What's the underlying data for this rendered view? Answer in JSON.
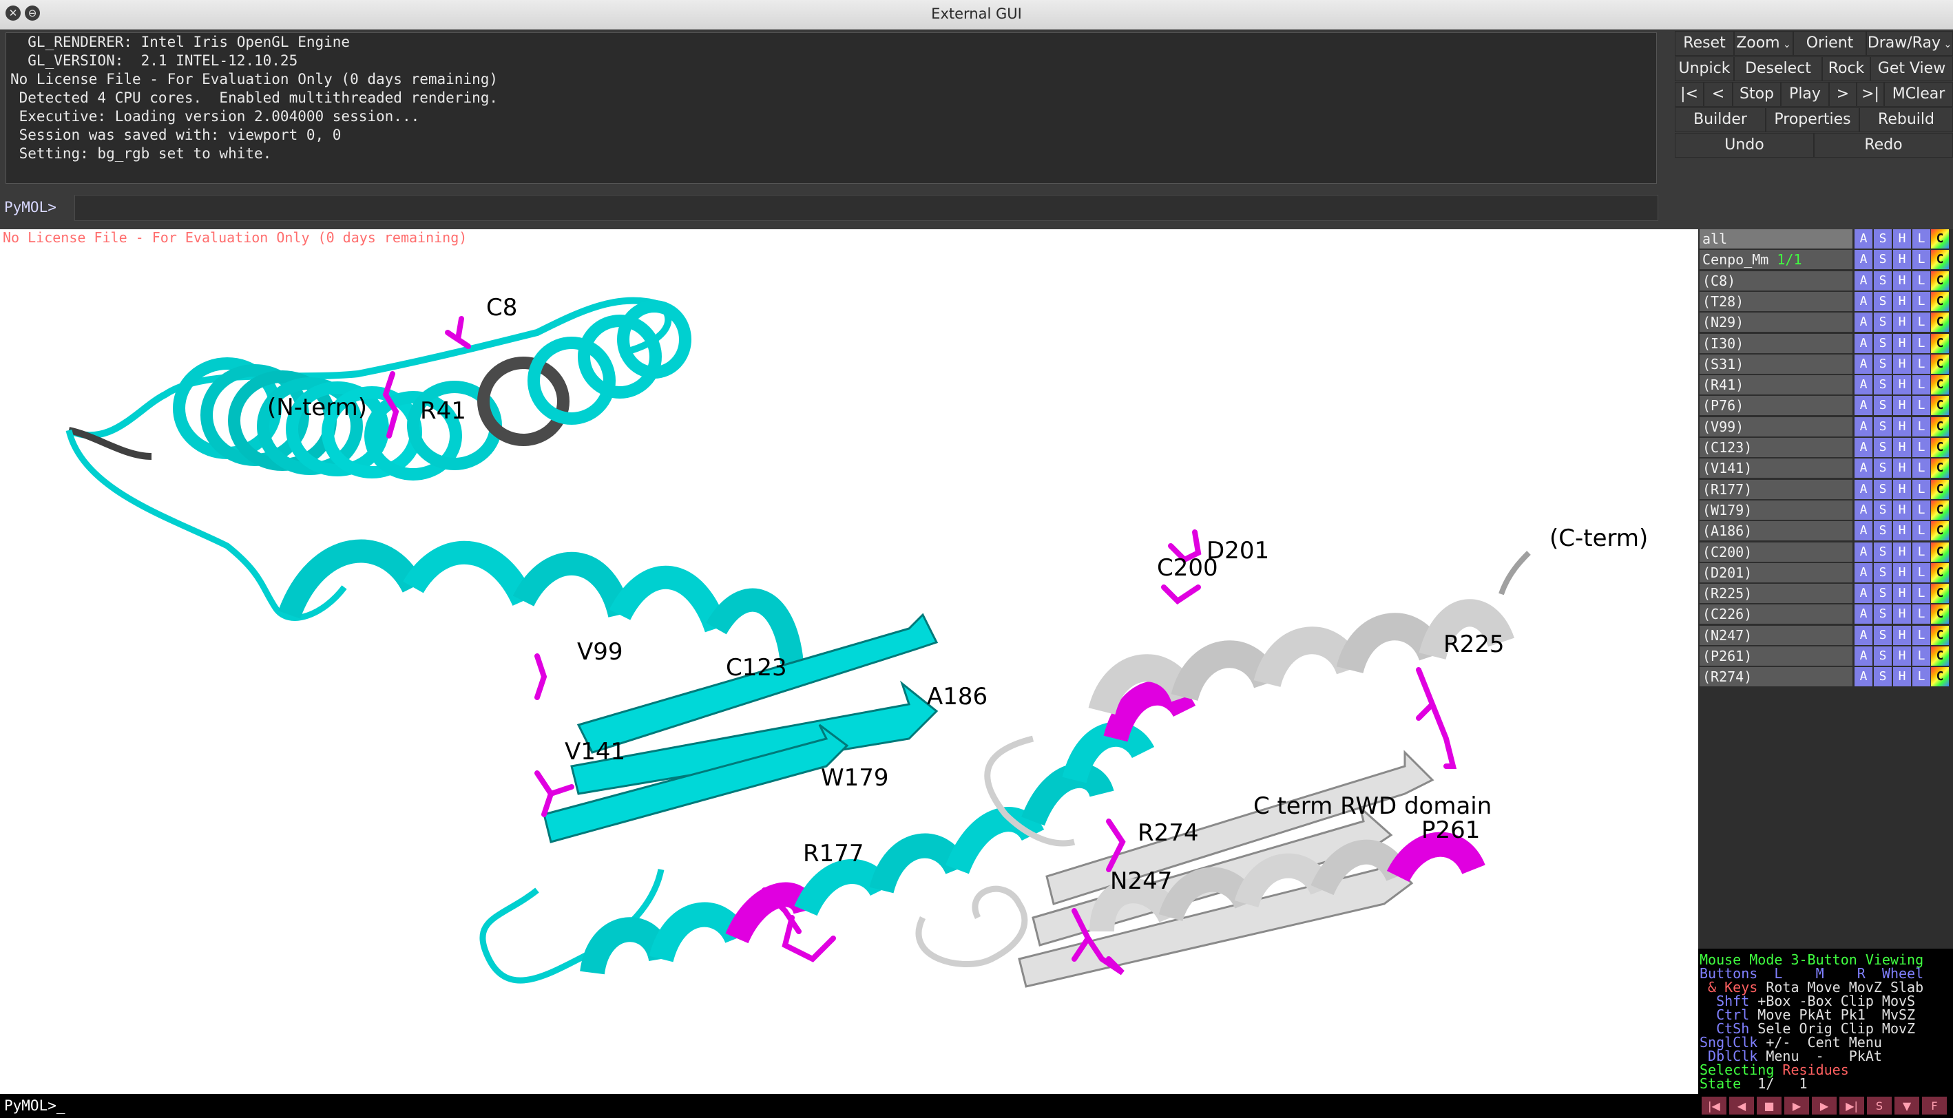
{
  "window": {
    "title": "External GUI"
  },
  "console": {
    "lines": [
      "  GL_RENDERER: Intel Iris OpenGL Engine",
      "  GL_VERSION:  2.1 INTEL-12.10.25",
      "No License File - For Evaluation Only (0 days remaining)",
      " Detected 4 CPU cores.  Enabled multithreaded rendering.",
      " Executive: Loading version 2.004000 session...",
      " Session was saved with: viewport 0, 0",
      " Setting: bg_rgb set to white."
    ],
    "prompt": "PyMOL>"
  },
  "buttons": {
    "row1": [
      "Reset",
      "Zoom",
      "Orient",
      "Draw/Ray"
    ],
    "row2": [
      "Unpick",
      "Deselect",
      "Rock",
      "Get View"
    ],
    "row3": [
      "|<",
      "<",
      "Stop",
      "Play",
      ">",
      ">|",
      "MClear"
    ],
    "row4": [
      "Builder",
      "Properties",
      "Rebuild"
    ],
    "row5": [
      "Undo",
      "Redo"
    ]
  },
  "viewer": {
    "license_notice": "No License File - For Evaluation Only (0 days remaining)",
    "labels": {
      "c8": "C8",
      "nterm": "(N-term)",
      "r41": "R41",
      "v99": "V99",
      "c123": "C123",
      "v141": "V141",
      "a186": "A186",
      "w179": "W179",
      "r177": "R177",
      "c200": "C200",
      "d201": "D201",
      "cterm": "(C-term)",
      "r225": "R225",
      "rwd": "C term RWD domain",
      "p261": "P261",
      "r274": "R274",
      "n247": "N247"
    },
    "colors": {
      "helix_domain": "#00e5e5",
      "rwd_domain": "#d9d9d9",
      "mutations": "#e600e6",
      "linker": "#404040"
    }
  },
  "objects": [
    {
      "name": "all",
      "count": ""
    },
    {
      "name": "Cenpo_Mm",
      "count": "1/1"
    },
    {
      "name": "(C8)"
    },
    {
      "name": "(T28)"
    },
    {
      "name": "(N29)"
    },
    {
      "name": "(I30)"
    },
    {
      "name": "(S31)"
    },
    {
      "name": "(R41)"
    },
    {
      "name": "(P76)"
    },
    {
      "name": "(V99)"
    },
    {
      "name": "(C123)"
    },
    {
      "name": "(V141)"
    },
    {
      "name": "(R177)"
    },
    {
      "name": "(W179)"
    },
    {
      "name": "(A186)"
    },
    {
      "name": "(C200)"
    },
    {
      "name": "(D201)"
    },
    {
      "name": "(R225)"
    },
    {
      "name": "(C226)"
    },
    {
      "name": "(N247)"
    },
    {
      "name": "(P261)"
    },
    {
      "name": "(R274)"
    }
  ],
  "object_buttons": [
    "A",
    "S",
    "H",
    "L",
    "C"
  ],
  "mouse": {
    "mode_label": "Mouse Mode",
    "mode_value": "3-Button Viewing",
    "buttons_header": "Buttons  L    M    R  Wheel",
    "keys_label": " & Keys",
    "keys_row": "Rota Move MovZ Slab",
    "shft_label": "  Shft",
    "shft_row": "+Box -Box Clip MovS",
    "ctrl_label": "  Ctrl",
    "ctrl_row": "Move PkAt Pk1  MvSZ",
    "ctsh_label": "  CtSh",
    "ctsh_row": "Sele Orig Clip MovZ",
    "snglclk_label": "SnglClk",
    "snglclk_row": "+/-  Cent Menu",
    "dblclk_label": " DblClk",
    "dblclk_row": "Menu  -   PkAt",
    "selecting_label": "Selecting",
    "selecting_value": "Residues",
    "state_label": "State",
    "state_value": "  1/   1"
  },
  "bottom": {
    "prompt": "PyMOL>_"
  },
  "playback": [
    "|◀",
    "◀",
    "■",
    "▶",
    "▶",
    "▶|",
    "S",
    "▼",
    "F"
  ]
}
